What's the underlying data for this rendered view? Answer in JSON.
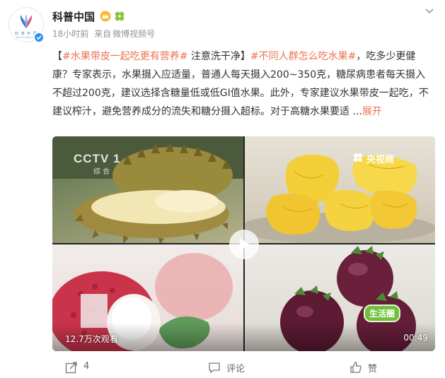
{
  "post": {
    "author": "科普中国",
    "time": "18小时前",
    "source_prefix": "来自",
    "source": "微博视频号",
    "avatar_text": "科 普 中 国",
    "avatar_subtext": "KE PU ZHONG GUO",
    "text": {
      "bracket_open": "【",
      "topic1": "#水果带皮一起吃更有营养#",
      "title_tail": " 注意洗干净】",
      "topic2": "#不同人群怎么吃水果#",
      "body": "，吃多少更健康？专家表示，水果摄入应适量，普通人每天摄入200~350克，糖尿病患者每天摄入不超过200克，建议选择含糖量低或低GI值水果。此外，专家建议水果带皮一起吃，不建议榨汁，避免营养成分的流失和糖分摄入超标。对于高糖水果要适 ...",
      "expand": "展开"
    },
    "media": {
      "cctv_logo": "CCTV 1",
      "cctv_sub": "综 合",
      "yangshipin": "央视频",
      "life_badge": "生活圈",
      "views": "12.7万次观看",
      "duration": "00:49"
    },
    "actions": {
      "share_count": "4",
      "comment_label": "评论",
      "like_label": "赞"
    }
  },
  "colors": {
    "topic": "#eb7350",
    "verified": "#2f8fe9",
    "meta": "#939393"
  }
}
